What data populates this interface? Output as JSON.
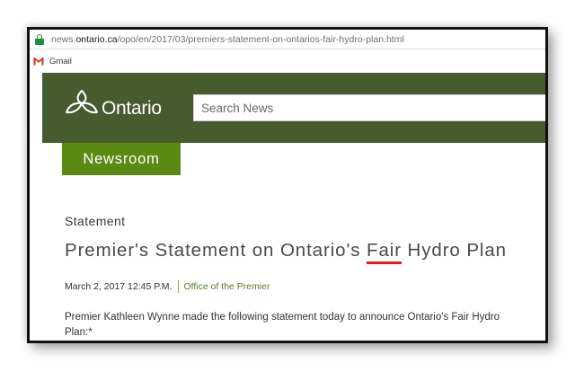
{
  "browser": {
    "url_prefix": "news.",
    "url_host": "ontario.ca",
    "url_path": "/opo/en/2017/03/premiers-statement-on-ontarios-fair-hydro-plan.html",
    "bookmarks": [
      {
        "label": "Gmail",
        "icon": "gmail-icon"
      }
    ]
  },
  "header": {
    "logo_text": "Ontario",
    "logo_icon": "trillium-logo-icon",
    "search_placeholder": "Search News"
  },
  "nav": {
    "newsroom_label": "Newsroom"
  },
  "article": {
    "kicker": "Statement",
    "headline_before": "Premier's Statement on Ontario's ",
    "headline_flagged_word": "Fair",
    "headline_after": " Hydro Plan",
    "date": "March 2, 2017 12:45 P.M.",
    "office": "Office of the Premier",
    "lead": "Premier Kathleen Wynne made the following statement today to announce Ontario's Fair Hydro Plan:*"
  },
  "colors": {
    "header_bg": "#465c2e",
    "newsroom_bg": "#5a8a12",
    "spellcheck_underline": "#e01b1b",
    "secure_lock": "#1e8e3e"
  }
}
